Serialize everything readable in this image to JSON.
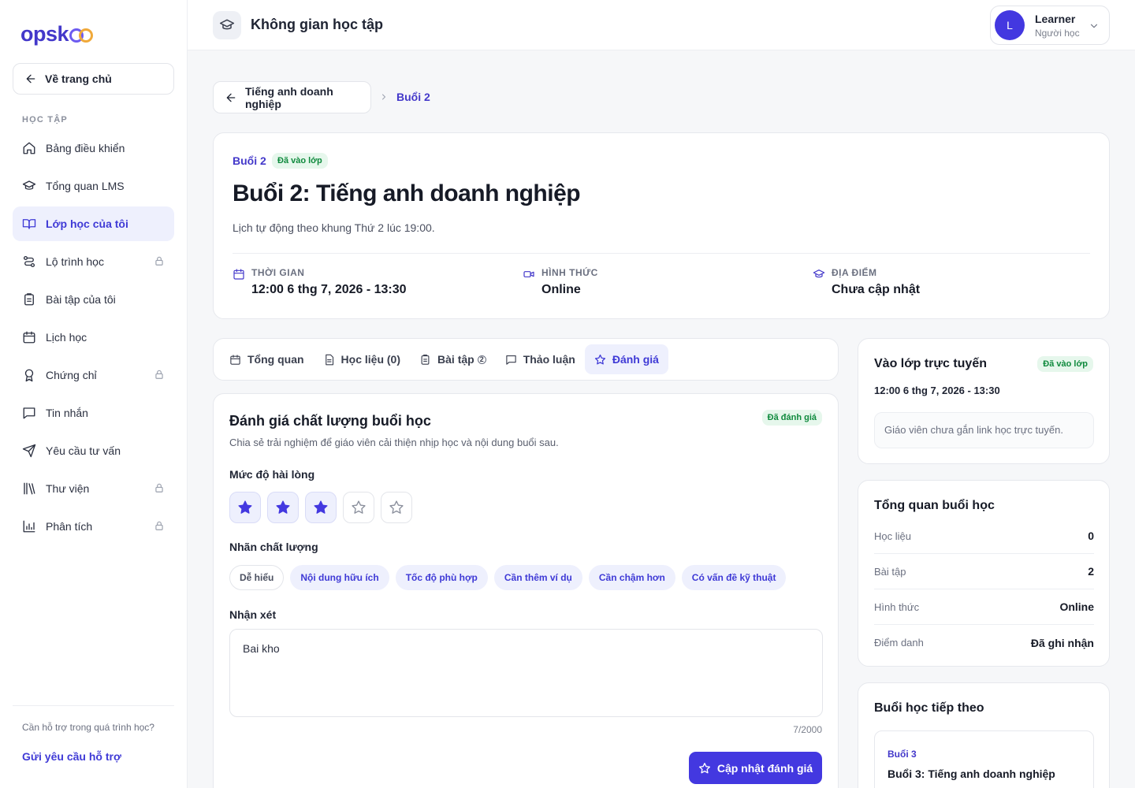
{
  "brand": {
    "name": "opsk"
  },
  "sidebar": {
    "back_label": "Về trang chủ",
    "section_label": "HỌC TẬP",
    "items": [
      {
        "label": "Bảng điều khiển",
        "icon": "home-icon",
        "active": false,
        "locked": false
      },
      {
        "label": "Tổng quan LMS",
        "icon": "graduation-cap-icon",
        "active": false,
        "locked": false
      },
      {
        "label": "Lớp học của tôi",
        "icon": "book-open-icon",
        "active": true,
        "locked": false
      },
      {
        "label": "Lộ trình học",
        "icon": "route-icon",
        "active": false,
        "locked": true
      },
      {
        "label": "Bài tập của tôi",
        "icon": "clipboard-icon",
        "active": false,
        "locked": false
      },
      {
        "label": "Lịch học",
        "icon": "calendar-icon",
        "active": false,
        "locked": false
      },
      {
        "label": "Chứng chỉ",
        "icon": "award-icon",
        "active": false,
        "locked": true
      },
      {
        "label": "Tin nhắn",
        "icon": "message-icon",
        "active": false,
        "locked": false
      },
      {
        "label": "Yêu cầu tư vấn",
        "icon": "send-icon",
        "active": false,
        "locked": false
      },
      {
        "label": "Thư viện",
        "icon": "library-icon",
        "active": false,
        "locked": true
      },
      {
        "label": "Phân tích",
        "icon": "bar-chart-icon",
        "active": false,
        "locked": true
      }
    ],
    "footer_question": "Cần hỗ trợ trong quá trình học?",
    "footer_link": "Gửi yêu cầu hỗ trợ"
  },
  "topbar": {
    "title": "Không gian học tập",
    "user": {
      "initial": "L",
      "name": "Learner",
      "role": "Người học"
    }
  },
  "breadcrumb": {
    "back_label": "Tiếng anh doanh nghiệp",
    "current": "Buổi 2"
  },
  "session": {
    "label": "Buổi 2",
    "status": "Đã vào lớp",
    "title": "Buổi 2: Tiếng anh doanh nghiệp",
    "description": "Lịch tự động theo khung Thứ 2 lúc 19:00.",
    "meta": {
      "time": {
        "key": "THỜI GIAN",
        "value": "12:00 6 thg 7, 2026 - 13:30"
      },
      "format": {
        "key": "HÌNH THỨC",
        "value": "Online"
      },
      "location": {
        "key": "ĐỊA ĐIỂM",
        "value": "Chưa cập nhật"
      }
    }
  },
  "tabs": [
    {
      "label": "Tổng quan",
      "icon": "calendar-icon",
      "active": false
    },
    {
      "label": "Học liệu (0)",
      "icon": "document-icon",
      "active": false
    },
    {
      "label": "Bài tập",
      "badge": "2",
      "icon": "clipboard-icon",
      "active": false
    },
    {
      "label": "Thảo luận",
      "icon": "message-icon",
      "active": false
    },
    {
      "label": "Đánh giá",
      "icon": "star-icon",
      "active": true
    }
  ],
  "rating": {
    "title": "Đánh giá chất lượng buổi học",
    "status": "Đã đánh giá",
    "description": "Chia sẻ trải nghiệm để giáo viên cải thiện nhịp học và nội dung buổi sau.",
    "satisfaction_label": "Mức độ hài lòng",
    "stars": 3,
    "max_stars": 5,
    "tags_label": "Nhãn chất lượng",
    "tags": [
      {
        "label": "Dễ hiểu",
        "selected": false
      },
      {
        "label": "Nội dung hữu ích",
        "selected": true
      },
      {
        "label": "Tốc độ phù hợp",
        "selected": true
      },
      {
        "label": "Cần thêm ví dụ",
        "selected": true
      },
      {
        "label": "Cần chậm hơn",
        "selected": true
      },
      {
        "label": "Có vấn đề kỹ thuật",
        "selected": true
      }
    ],
    "comment_label": "Nhận xét",
    "comment_value": "Bai kho",
    "char_count": "7/2000",
    "submit_label": "Cập nhật đánh giá"
  },
  "online_class": {
    "title": "Vào lớp trực tuyến",
    "status": "Đã vào lớp",
    "time": "12:00 6 thg 7, 2026 - 13:30",
    "note": "Giáo viên chưa gắn link học trực tuyến."
  },
  "overview": {
    "title": "Tổng quan buổi học",
    "rows": [
      {
        "key": "Học liệu",
        "value": "0"
      },
      {
        "key": "Bài tập",
        "value": "2"
      },
      {
        "key": "Hình thức",
        "value": "Online"
      },
      {
        "key": "Điểm danh",
        "value": "Đã ghi nhận"
      }
    ]
  },
  "next_session": {
    "title": "Buổi học tiếp theo",
    "label": "Buổi 3",
    "name": "Buổi 3: Tiếng anh doanh nghiệp"
  },
  "colors": {
    "accent": "#4338e0",
    "success": "#0f8a3d",
    "success_bg": "#e6f7ec"
  }
}
